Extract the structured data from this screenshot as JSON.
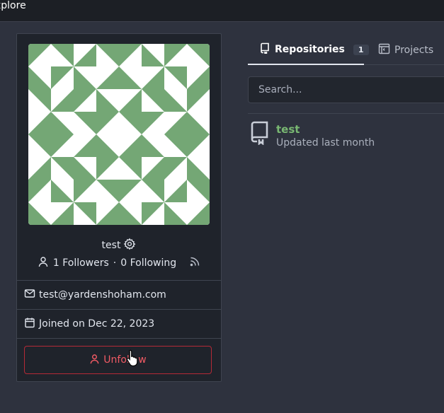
{
  "topbar": {
    "explore_label": "xplore"
  },
  "profile": {
    "username": "test",
    "followers": "1 Followers",
    "separator": "·",
    "following": "0 Following",
    "email": "test@yardenshoham.com",
    "joined": "Joined on Dec 22, 2023",
    "unfollow_label": "Unfollow"
  },
  "tabs": [
    {
      "label": "Repositories",
      "count": "1"
    },
    {
      "label": "Projects"
    }
  ],
  "search": {
    "placeholder": "Search..."
  },
  "repos": [
    {
      "name": "test",
      "updated": "Updated last month"
    }
  ],
  "colors": {
    "avatar_green": "#74a775",
    "accent_green": "#79b872",
    "danger": "#f05a64"
  },
  "icons": [
    "gear-icon",
    "person-icon",
    "rss-icon",
    "mail-icon",
    "calendar-icon",
    "repo-icon",
    "project-icon",
    "hand-cursor-icon"
  ]
}
